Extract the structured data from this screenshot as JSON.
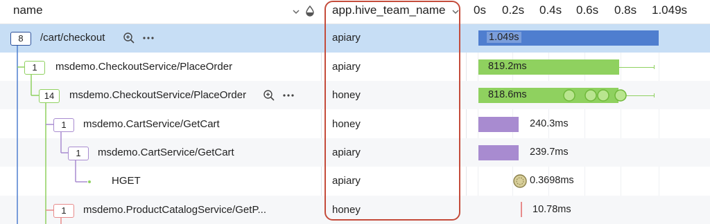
{
  "header": {
    "name_label": "name",
    "team_label": "app.hive_team_name",
    "ticks": [
      "0s",
      "0.2s",
      "0.4s",
      "0.6s",
      "0.8s",
      "1.049s"
    ]
  },
  "rows": [
    {
      "badge": "8",
      "name": "/cart/checkout",
      "team": "apiary",
      "duration": "1.049s"
    },
    {
      "badge": "1",
      "name": "msdemo.CheckoutService/PlaceOrder",
      "team": "apiary",
      "duration": "819.2ms"
    },
    {
      "badge": "14",
      "name": "msdemo.CheckoutService/PlaceOrder",
      "team": "honey",
      "duration": "818.6ms"
    },
    {
      "badge": "1",
      "name": "msdemo.CartService/GetCart",
      "team": "honey",
      "duration": "240.3ms"
    },
    {
      "badge": "1",
      "name": "msdemo.CartService/GetCart",
      "team": "apiary",
      "duration": "239.7ms"
    },
    {
      "badge": "",
      "name": "HGET",
      "team": "apiary",
      "duration": "0.3698ms"
    },
    {
      "badge": "1",
      "name": "msdemo.ProductCatalogService/GetP...",
      "team": "honey",
      "duration": "10.78ms"
    }
  ],
  "icons": {
    "zoom": "zoom-in-icon",
    "more": "more-options-icon",
    "sort": "chevron-down-icon",
    "color": "drop-icon"
  },
  "colors": {
    "selected_row": "#c7def5",
    "blue_bar": "#4f7ecf",
    "green_bar": "#8fd15f",
    "purple_bar": "#a88bd0",
    "red_bar": "#e88b8b",
    "highlight": "#c44b3a"
  }
}
